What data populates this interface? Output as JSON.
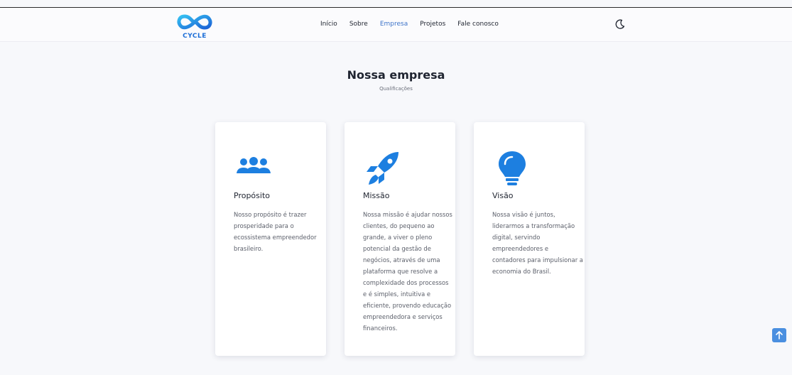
{
  "brand": {
    "logo_text": "CYCLE",
    "color": "#1d6fd8"
  },
  "nav": {
    "items": [
      {
        "label": "Início",
        "active": false
      },
      {
        "label": "Sobre",
        "active": false
      },
      {
        "label": "Empresa",
        "active": true
      },
      {
        "label": "Projetos",
        "active": false
      },
      {
        "label": "Fale conosco",
        "active": false
      }
    ],
    "theme_toggle_icon": "moon-icon"
  },
  "section": {
    "title": "Nossa empresa",
    "subtitle": "Qualificações"
  },
  "cards": [
    {
      "icon": "users-icon",
      "title": "Propósito",
      "text": "Nosso propósito é trazer prosperidade para o ecossistema empreendedor brasileiro."
    },
    {
      "icon": "rocket-icon",
      "title": "Missão",
      "text": "Nossa missão é ajudar nossos clientes, do pequeno ao grande, a viver o pleno potencial da gestão de negócios, através de uma plataforma que resolve a complexidade dos processos e é simples, intuitiva e eficiente, provendo educação empreendedora e serviços financeiros."
    },
    {
      "icon": "lightbulb-icon",
      "title": "Visão",
      "text": "Nossa visão é juntos, liderarmos a transformação digital, servindo empreendedores e contadores para impulsionar a economia do Brasil."
    }
  ],
  "back_to_top": {
    "icon": "arrow-up-icon"
  },
  "colors": {
    "accent": "#3e74c9",
    "icon_blue": "#1d7fe0",
    "background": "#f7f8fb"
  }
}
